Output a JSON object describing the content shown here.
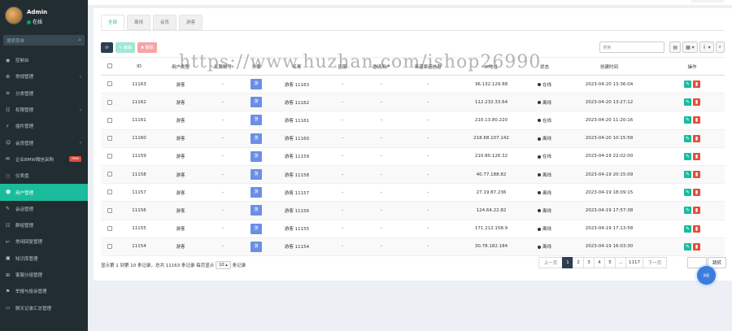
{
  "sidebar": {
    "user_name": "Admin",
    "user_status": "在线",
    "search_placeholder": "搜索菜单",
    "items": [
      {
        "label": "控制台",
        "icon": "dashboard-icon",
        "arrow": false
      },
      {
        "label": "常规管理",
        "icon": "cogs-icon",
        "arrow": true
      },
      {
        "label": "分类管理",
        "icon": "list-icon",
        "arrow": false
      },
      {
        "label": "权限管理",
        "icon": "group-icon",
        "arrow": true
      },
      {
        "label": "插件管理",
        "icon": "plug-icon",
        "arrow": false
      },
      {
        "label": "会员管理",
        "icon": "user-icon",
        "arrow": true
      },
      {
        "label": "企业BMW微信采购",
        "icon": "wechat-icon",
        "arrow": false,
        "badge": "new"
      },
      {
        "label": "仪表盘",
        "icon": "circle-icon",
        "arrow": false
      },
      {
        "label": "用户管理",
        "icon": "users-icon",
        "arrow": false,
        "active": true
      },
      {
        "label": "会话管理",
        "icon": "comments-icon",
        "arrow": false
      },
      {
        "label": "群组管理",
        "icon": "group-icon",
        "arrow": false
      },
      {
        "label": "常用回复管理",
        "icon": "reply-icon",
        "arrow": false
      },
      {
        "label": "知识库管理",
        "icon": "book-icon",
        "arrow": false
      },
      {
        "label": "客服分组管理",
        "icon": "sitemap-icon",
        "arrow": false
      },
      {
        "label": "举报与投诉管理",
        "icon": "flag-icon",
        "arrow": false
      },
      {
        "label": "聊天记录汇总管理",
        "icon": "file-icon",
        "arrow": false
      }
    ]
  },
  "tabs": [
    "全部",
    "离线",
    "会员",
    "游客"
  ],
  "toolbar": {
    "edit": "编辑",
    "delete": "删除"
  },
  "search_placeholder": "搜索",
  "table": {
    "headers": [
      "ID",
      "用户类型",
      "关联账号",
      "头像",
      "名称",
      "区服",
      "邀请用户",
      "来源渠道信息",
      "IP地址",
      "状态",
      "创建时间",
      "操作"
    ],
    "rows": [
      {
        "id": "11163",
        "type": "游客",
        "account": "-",
        "avatar": "游",
        "name": "游客 11163",
        "zone": "-",
        "invite": "-",
        "channel": "-",
        "ip": "36.132.129.88",
        "status": "在线",
        "time": "2023-04-20 13:36:04"
      },
      {
        "id": "11162",
        "type": "游客",
        "account": "-",
        "avatar": "游",
        "name": "游客 11162",
        "zone": "-",
        "invite": "-",
        "channel": "-",
        "ip": "112.232.33.64",
        "status": "离线",
        "time": "2023-04-20 13:27:12"
      },
      {
        "id": "11161",
        "type": "游客",
        "account": "-",
        "avatar": "游",
        "name": "游客 11161",
        "zone": "-",
        "invite": "-",
        "channel": "-",
        "ip": "210.13.80.220",
        "status": "在线",
        "time": "2023-04-20 11:20:16"
      },
      {
        "id": "11160",
        "type": "游客",
        "account": "-",
        "avatar": "游",
        "name": "游客 11160",
        "zone": "-",
        "invite": "-",
        "channel": "-",
        "ip": "218.68.107.142",
        "status": "离线",
        "time": "2023-04-20 10:15:58"
      },
      {
        "id": "11159",
        "type": "游客",
        "account": "-",
        "avatar": "游",
        "name": "游客 11159",
        "zone": "-",
        "invite": "-",
        "channel": "-",
        "ip": "210.80.126.32",
        "status": "在线",
        "time": "2023-04-19 22:02:00"
      },
      {
        "id": "11158",
        "type": "游客",
        "account": "-",
        "avatar": "游",
        "name": "游客 11158",
        "zone": "-",
        "invite": "-",
        "channel": "-",
        "ip": "40.77.188.82",
        "status": "离线",
        "time": "2023-04-19 20:15:09"
      },
      {
        "id": "11157",
        "type": "游客",
        "account": "-",
        "avatar": "游",
        "name": "游客 11157",
        "zone": "-",
        "invite": "-",
        "channel": "-",
        "ip": "27.19.87.236",
        "status": "离线",
        "time": "2023-04-19 18:09:15"
      },
      {
        "id": "11156",
        "type": "游客",
        "account": "-",
        "avatar": "游",
        "name": "游客 11156",
        "zone": "-",
        "invite": "-",
        "channel": "-",
        "ip": "124.64.22.82",
        "status": "离线",
        "time": "2023-04-19 17:57:38"
      },
      {
        "id": "11155",
        "type": "游客",
        "account": "-",
        "avatar": "游",
        "name": "游客 11155",
        "zone": "-",
        "invite": "-",
        "channel": "-",
        "ip": "171.212.158.9",
        "status": "离线",
        "time": "2023-04-19 17:13:58"
      },
      {
        "id": "11154",
        "type": "游客",
        "account": "-",
        "avatar": "游",
        "name": "游客 11154",
        "zone": "-",
        "invite": "-",
        "channel": "-",
        "ip": "30.78.182.184",
        "status": "离线",
        "time": "2023-04-19 16:03:30"
      }
    ]
  },
  "footer": {
    "info_prefix": "显示第 1 到第 10 条记录，总共 11163 条记录 每页显示",
    "page_size": "10",
    "info_suffix": "条记录"
  },
  "pager": [
    "上一页",
    "1",
    "2",
    "3",
    "4",
    "5",
    "...",
    "1117",
    "下一页"
  ],
  "pager_active": "1",
  "jump_label": "跳转",
  "hi_label": "Hi",
  "watermark": "https://www.huzhan.com/ishop26990"
}
